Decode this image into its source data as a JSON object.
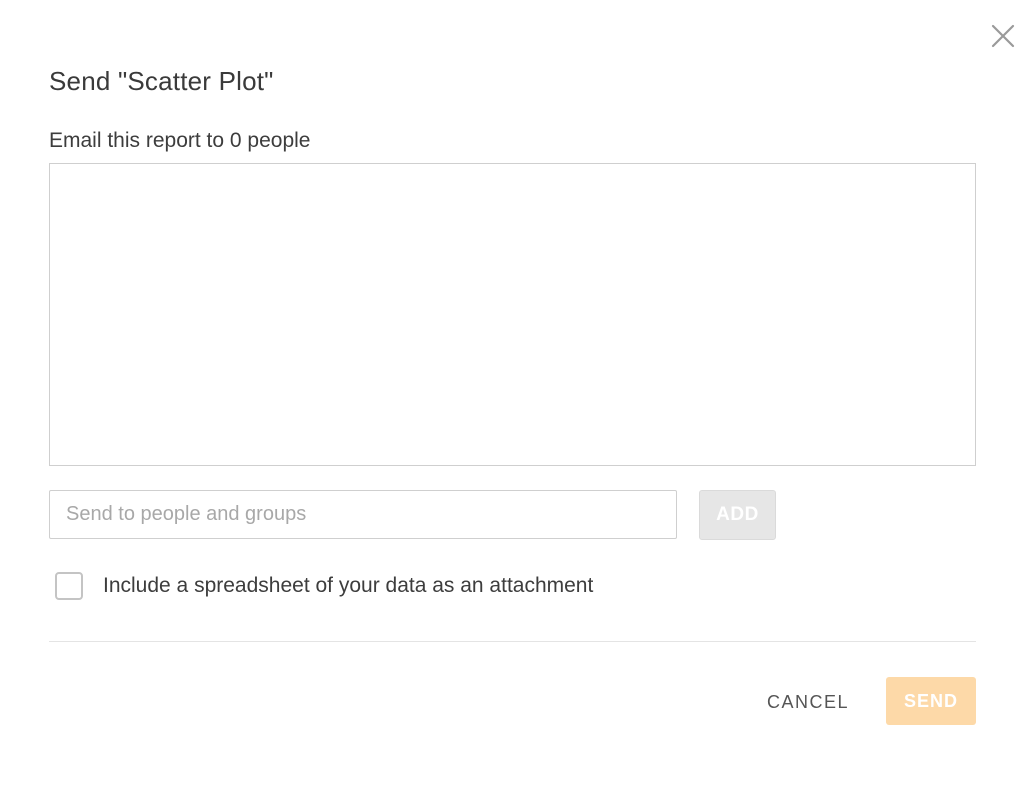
{
  "dialog": {
    "title": "Send \"Scatter Plot\"",
    "close_icon": "close-icon"
  },
  "recipients": {
    "label": "Email this report to 0 people",
    "items": []
  },
  "search": {
    "value": "",
    "placeholder": "Send to people and groups"
  },
  "add_button": {
    "label": "ADD",
    "enabled": false
  },
  "attachment": {
    "label": "Include a spreadsheet of your data as an attachment",
    "checked": false
  },
  "footer": {
    "cancel_label": "CANCEL",
    "send_label": "SEND",
    "send_enabled": false
  },
  "colors": {
    "send_disabled_bg": "#fdd9a8",
    "add_disabled_bg": "#e6e6e6",
    "border": "#cfcfcf"
  }
}
